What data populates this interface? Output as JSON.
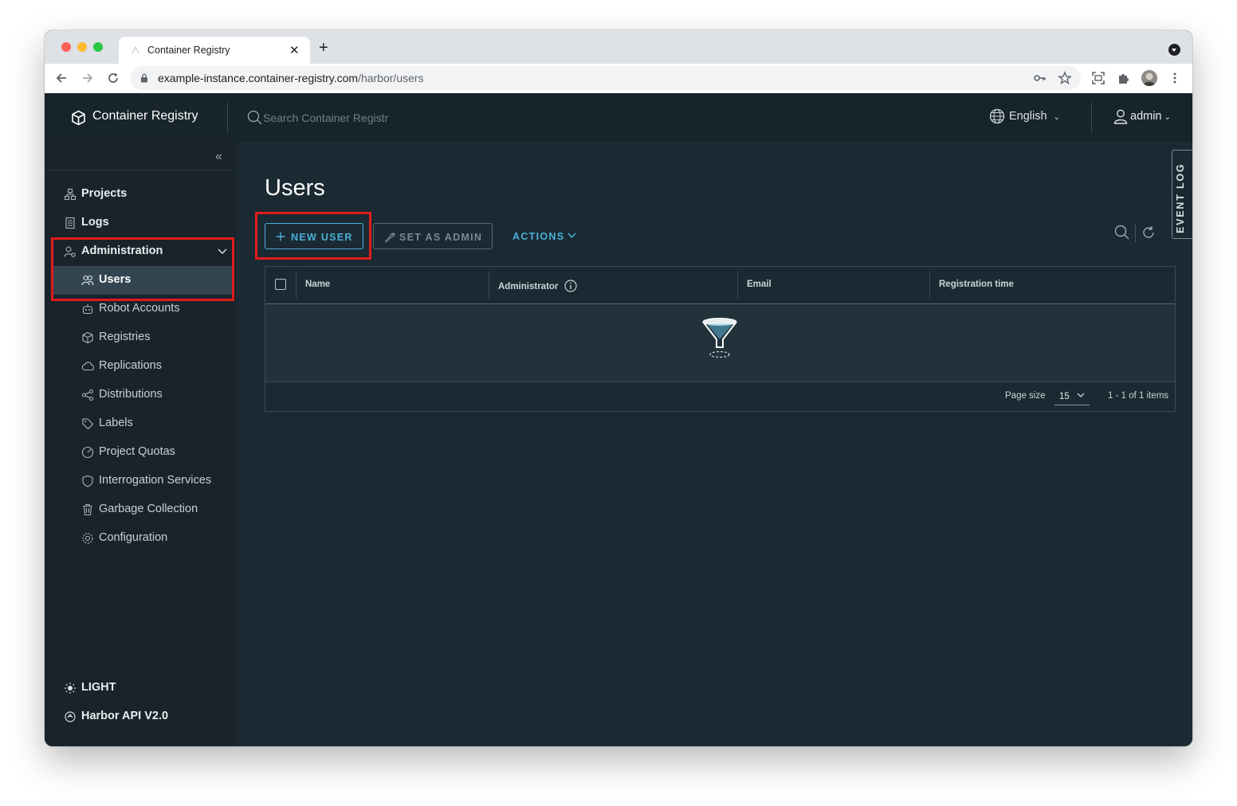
{
  "browser": {
    "tab_title": "Container Registry",
    "url_host": "example-instance.container-registry.com",
    "url_path": "/harbor/users"
  },
  "header": {
    "brand": "Container Registry",
    "search_placeholder": "Search Container Registr",
    "language": "English",
    "user": "admin"
  },
  "sidebar": {
    "items": [
      {
        "label": "Projects",
        "icon": "projects-icon"
      },
      {
        "label": "Logs",
        "icon": "logs-icon"
      },
      {
        "label": "Administration",
        "icon": "administration-icon"
      }
    ],
    "admin_items": [
      {
        "label": "Users",
        "icon": "users-icon",
        "active": true
      },
      {
        "label": "Robot Accounts",
        "icon": "robot-icon"
      },
      {
        "label": "Registries",
        "icon": "registries-icon"
      },
      {
        "label": "Replications",
        "icon": "replications-icon"
      },
      {
        "label": "Distributions",
        "icon": "distributions-icon"
      },
      {
        "label": "Labels",
        "icon": "labels-icon"
      },
      {
        "label": "Project Quotas",
        "icon": "quotas-icon"
      },
      {
        "label": "Interrogation Services",
        "icon": "interrogation-icon"
      },
      {
        "label": "Garbage Collection",
        "icon": "garbage-icon"
      },
      {
        "label": "Configuration",
        "icon": "configuration-icon"
      }
    ],
    "theme_toggle": "LIGHT",
    "api_link": "Harbor API V2.0"
  },
  "main": {
    "title": "Users",
    "buttons": {
      "new_user": "NEW USER",
      "set_admin": "SET AS ADMIN",
      "actions": "ACTIONS"
    },
    "event_log": "EVENT LOG",
    "table": {
      "columns": [
        "Name",
        "Administrator",
        "Email",
        "Registration time"
      ],
      "page_size_label": "Page size",
      "page_size": "15",
      "pagination": "1 - 1 of 1 items"
    }
  },
  "colors": {
    "accent": "#49afd9",
    "highlight": "#e21b1b",
    "header_bg": "#17242b",
    "sidebar_bg": "#1a2329",
    "main_bg": "#1b2a32"
  }
}
